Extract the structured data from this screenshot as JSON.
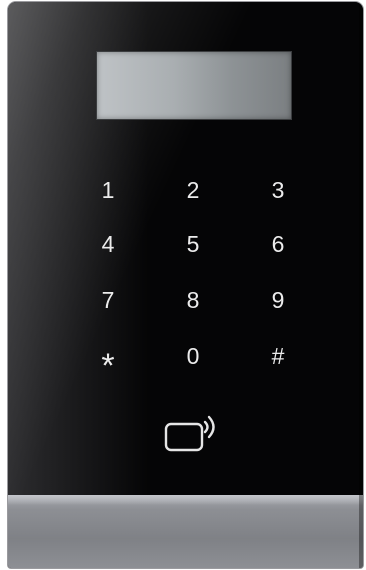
{
  "keypad": {
    "keys": [
      "1",
      "2",
      "3",
      "4",
      "5",
      "6",
      "7",
      "8",
      "9",
      "*",
      "0",
      "#"
    ]
  },
  "icons": {
    "card_reader": "contactless-card-icon"
  },
  "colors": {
    "glass": "#050506",
    "key_text": "#ececec",
    "lcd": "#a9aeb1",
    "frame": "#8d8f94"
  }
}
